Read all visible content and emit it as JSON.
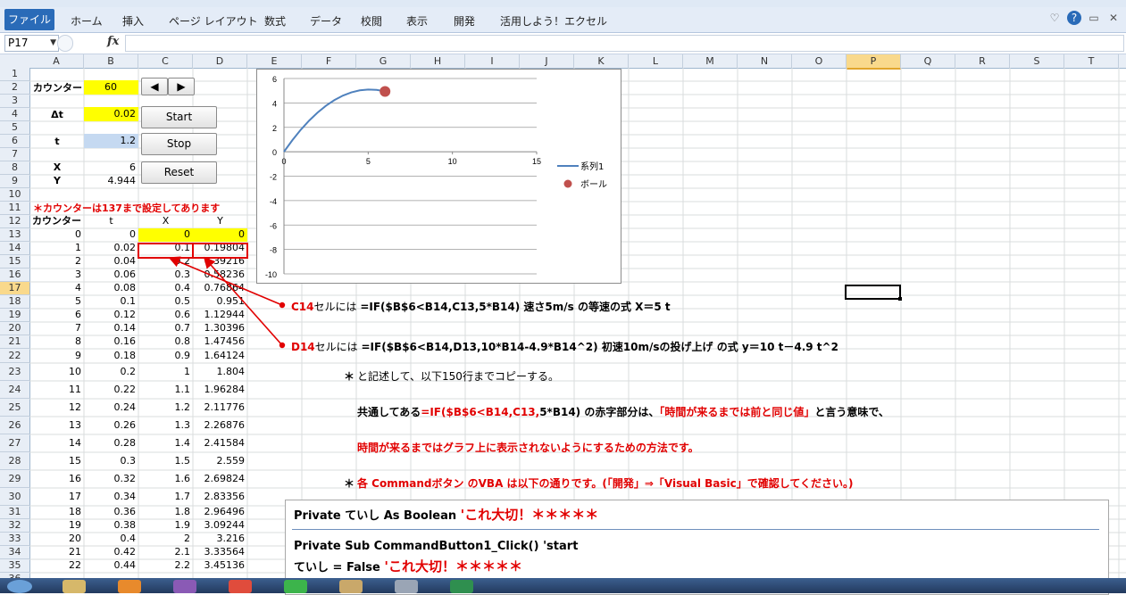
{
  "ribbon": {
    "tabs": [
      "ファイル",
      "ホーム",
      "挿入",
      "ページ レイアウト",
      "数式",
      "データ",
      "校閲",
      "表示",
      "開発",
      "活用しよう！エクセル"
    ]
  },
  "formula_bar": {
    "name_box": "P17",
    "fx": "fx",
    "formula": ""
  },
  "columns": [
    "A",
    "B",
    "C",
    "D",
    "E",
    "F",
    "G",
    "H",
    "I",
    "J",
    "K",
    "L",
    "M",
    "N",
    "O",
    "P",
    "Q",
    "R",
    "S",
    "T"
  ],
  "selected_column": "P",
  "rows": [
    "1",
    "2",
    "3",
    "4",
    "5",
    "6",
    "7",
    "8",
    "9",
    "10",
    "11",
    "12",
    "13",
    "14",
    "15",
    "16",
    "17",
    "18",
    "19",
    "20",
    "21",
    "22",
    "23",
    "24",
    "25",
    "26",
    "27",
    "28",
    "29",
    "30",
    "31",
    "32",
    "33",
    "34",
    "35",
    "36"
  ],
  "selected_row": "17",
  "controls": {
    "counter_label": "カウンター",
    "counter_value": "60",
    "spin_left": "◀",
    "spin_right": "▶",
    "dt_label": "Δt",
    "dt_value": "0.02",
    "t_label": "t",
    "t_value": "1.2",
    "x_label": "X",
    "x_value": "6",
    "y_label": "Y",
    "y_value": "4.944",
    "start": "Start",
    "stop": "Stop",
    "reset": "Reset",
    "note": "＊カウンターは137まで設定してあります"
  },
  "table": {
    "headers": [
      "カウンター",
      "t",
      "X",
      "Y"
    ],
    "rows": [
      [
        "0",
        "0",
        "0",
        "0"
      ],
      [
        "1",
        "0.02",
        "0.1",
        "0.19804"
      ],
      [
        "2",
        "0.04",
        "0.2",
        "0.39216"
      ],
      [
        "3",
        "0.06",
        "0.3",
        "0.58236"
      ],
      [
        "4",
        "0.08",
        "0.4",
        "0.76864"
      ],
      [
        "5",
        "0.1",
        "0.5",
        "0.951"
      ],
      [
        "6",
        "0.12",
        "0.6",
        "1.12944"
      ],
      [
        "7",
        "0.14",
        "0.7",
        "1.30396"
      ],
      [
        "8",
        "0.16",
        "0.8",
        "1.47456"
      ],
      [
        "9",
        "0.18",
        "0.9",
        "1.64124"
      ],
      [
        "10",
        "0.2",
        "1",
        "1.804"
      ],
      [
        "11",
        "0.22",
        "1.1",
        "1.96284"
      ],
      [
        "12",
        "0.24",
        "1.2",
        "2.11776"
      ],
      [
        "13",
        "0.26",
        "1.3",
        "2.26876"
      ],
      [
        "14",
        "0.28",
        "1.4",
        "2.41584"
      ],
      [
        "15",
        "0.3",
        "1.5",
        "2.559"
      ],
      [
        "16",
        "0.32",
        "1.6",
        "2.69824"
      ],
      [
        "17",
        "0.34",
        "1.7",
        "2.83356"
      ],
      [
        "18",
        "0.36",
        "1.8",
        "2.96496"
      ],
      [
        "19",
        "0.38",
        "1.9",
        "3.09244"
      ],
      [
        "20",
        "0.4",
        "2",
        "3.216"
      ],
      [
        "21",
        "0.42",
        "2.1",
        "3.33564"
      ],
      [
        "22",
        "0.44",
        "2.2",
        "3.45136"
      ]
    ]
  },
  "annotations": {
    "c14_ref": "C14",
    "c14_mid": "セルには ",
    "c14_formula": "=IF($B$6<B14,C13,5*B14)  速さ5m/s  の等速の式  X＝5 t",
    "d14_ref": "D14",
    "d14_mid": "セルには ",
    "d14_formula": "=IF($B$6<B14,D13,10*B14-4.9*B14^2)         初速10m/sの投げ上げ の式  y＝10 t－4.9 t^2",
    "star1": "＊",
    "copy_note": "と記述して、以下150行までコピーする。",
    "common_a": "共通してある",
    "common_b": "=IF($B$6<B14,C13,",
    "common_c": "5*B14)  の赤字部分は、",
    "common_d": "「時間が来るまでは前と同じ値」",
    "common_e": "と言う意味で、",
    "explain2": "時間が来るまではグラフ上に表示されないようにするための方法です。",
    "star2": "＊",
    "vba_note": "各 Commandボタン のVBA は以下の通りです。(「開発」⇒「Visual Basic」で確認してください。)"
  },
  "vba": {
    "line1_a": "Private ていし As Boolean ",
    "line1_b": "'これ大切！＊＊＊＊＊",
    "line2": "Private Sub CommandButton1_Click() 'start",
    "line3_a": "ていし = False ",
    "line3_b": "'これ大切！＊＊＊＊＊"
  },
  "chart_data": {
    "type": "scatter",
    "xlim": [
      0,
      15
    ],
    "ylim": [
      -10,
      6
    ],
    "xticks": [
      "0",
      "5",
      "10",
      "15"
    ],
    "yticks": [
      "6",
      "4",
      "2",
      "0",
      "-2",
      "-4",
      "-6",
      "-8",
      "-10"
    ],
    "series": [
      {
        "name": "系列1",
        "style": "line",
        "color": "#4f81bd",
        "x": [
          0,
          0.5,
          1,
          1.5,
          2,
          2.5,
          3,
          3.5,
          4,
          4.5,
          5,
          5.5,
          6
        ],
        "y": [
          0,
          0.951,
          1.804,
          2.559,
          3.216,
          3.775,
          4.236,
          4.599,
          4.864,
          5.031,
          5.1,
          5.071,
          4.944
        ]
      },
      {
        "name": "ボール",
        "style": "marker",
        "color": "#c0504d",
        "x": [
          6
        ],
        "y": [
          4.944
        ]
      }
    ],
    "legend": "right"
  }
}
